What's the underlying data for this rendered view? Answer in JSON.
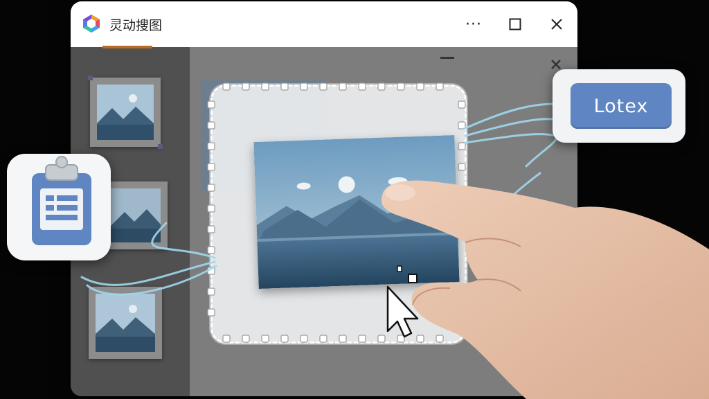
{
  "window": {
    "title": "灵动搜图",
    "more_label": "···",
    "controls": [
      "more",
      "maximize",
      "close"
    ]
  },
  "sidebar": {
    "thumbnails": [
      {
        "name": "landscape-thumbnail-1"
      },
      {
        "name": "landscape-thumbnail-2"
      },
      {
        "name": "landscape-thumbnail-3"
      }
    ]
  },
  "canvas": {
    "selected_image": "mountain-lake-landscape",
    "selection_style": "dashed-rounded"
  },
  "floating": {
    "clipboard_icon": "clipboard-document-icon",
    "lotex_button_label": "Lotex"
  },
  "colors": {
    "accent_blue": "#5f86c2",
    "titlebar_bg": "#ffffff",
    "sidebar_bg": "#505050",
    "canvas_bg": "#7d7d7d",
    "flow_lines": "#9fd8ee"
  }
}
